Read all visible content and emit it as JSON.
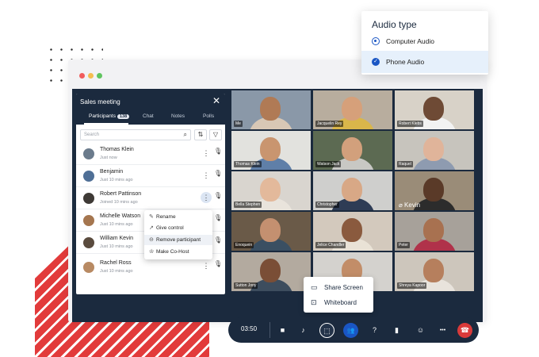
{
  "panel": {
    "title": "Sales meeting",
    "close": "✕",
    "tabs": [
      {
        "label": "Participants",
        "count": "138"
      },
      {
        "label": "Chat"
      },
      {
        "label": "Notes"
      },
      {
        "label": "Polls"
      }
    ],
    "search_placeholder": "Search",
    "participants": [
      {
        "name": "Thomas Klein",
        "status": "Just now",
        "avatar": "#6b7b8c"
      },
      {
        "name": "Benjamin",
        "status": "Just 10 mins ago",
        "avatar": "#4f6f96"
      },
      {
        "name": "Robert Pattinson",
        "status": "Joined 10 mins ago",
        "avatar": "#3e3a36"
      },
      {
        "name": "Michelle Watson",
        "status": "Just 10 mins ago",
        "avatar": "#a5764f"
      },
      {
        "name": "William Kevin",
        "status": "Just 10 mins ago",
        "avatar": "#5a4b3e"
      },
      {
        "name": "Rachel Ross",
        "status": "Just 10 mins ago",
        "avatar": "#b88a63"
      }
    ]
  },
  "context_menu": {
    "items": [
      {
        "label": "Rename",
        "icon": "pencil-icon",
        "glyph": "✎"
      },
      {
        "label": "Give control",
        "icon": "pointer-icon",
        "glyph": "↗"
      },
      {
        "label": "Remove participant",
        "icon": "remove-icon",
        "glyph": "⊖"
      },
      {
        "label": "Make Co-Host",
        "icon": "crown-icon",
        "glyph": "♔"
      }
    ]
  },
  "video_tiles": [
    {
      "name": "Me",
      "bg": "#8a98a8",
      "skin": "#b07a55",
      "shirt": "#d8c7b5"
    },
    {
      "name": "Jacquelin Rey",
      "bg": "#b8ad9e",
      "skin": "#d6a07a",
      "shirt": "#d9b64a"
    },
    {
      "name": "Robert Klebs",
      "bg": "#d8d2c8",
      "skin": "#6e4a35",
      "shirt": "#f2f2f2"
    },
    {
      "name": "Thomas Klein",
      "bg": "#e2e2de",
      "skin": "#c9956f",
      "shirt": "#5f7fa8"
    },
    {
      "name": "Watson Jack",
      "bg": "#5c6a52",
      "skin": "#d2a07c",
      "shirt": "#c8c8c4"
    },
    {
      "name": "Raquel",
      "bg": "#c7c4bd",
      "skin": "#e0b49a",
      "shirt": "#8e9bb0"
    },
    {
      "name": "Bella Stephen",
      "bg": "#d9d5cf",
      "skin": "#e3b99b",
      "shirt": "#e9e4dc"
    },
    {
      "name": "Christopher",
      "bg": "#cfcfcd",
      "skin": "#d8a886",
      "shirt": "#2e3c55"
    },
    {
      "name": "Kevin",
      "bg": "#9a8c78",
      "skin": "#5a3a28",
      "shirt": "#2c2c2c"
    },
    {
      "name": "Enoquein",
      "bg": "#6a5a48",
      "skin": "#c49070",
      "shirt": "#3a4f62"
    },
    {
      "name": "Jelice Chandler",
      "bg": "#d3c9bd",
      "skin": "#8a5a3e",
      "shirt": "#e9e2d6"
    },
    {
      "name": "Peter",
      "bg": "#a7a19a",
      "skin": "#a87150",
      "shirt": "#b0324a"
    },
    {
      "name": "Sutton Jony",
      "bg": "#b3aa9f",
      "skin": "#7a4e36",
      "shirt": "#3d4d5e"
    },
    {
      "name": "",
      "bg": "#d4d2ce",
      "skin": "#c28d68",
      "shirt": "#3a4660"
    },
    {
      "name": "Shreya Kapoor",
      "bg": "#cdc6bc",
      "skin": "#b67f5d",
      "shirt": "#e8e3dc"
    }
  ],
  "audio_popup": {
    "title": "Audio type",
    "options": [
      {
        "label": "Computer Audio"
      },
      {
        "label": "Phone Audio",
        "check": "✓"
      }
    ]
  },
  "share_menu": {
    "items": [
      {
        "label": "Share Screen",
        "glyph": "▭"
      },
      {
        "label": "Whiteboard",
        "glyph": "⊡"
      }
    ]
  },
  "toolbar": {
    "timer": "03:50",
    "buttons": [
      {
        "name": "camera-icon",
        "glyph": "■"
      },
      {
        "name": "microphone-icon",
        "glyph": "♪"
      },
      {
        "name": "share-screen-icon",
        "glyph": "⬚"
      },
      {
        "name": "participants-icon",
        "glyph": "👥"
      },
      {
        "name": "question-icon",
        "glyph": "?"
      },
      {
        "name": "stats-icon",
        "glyph": "▮"
      },
      {
        "name": "reactions-icon",
        "glyph": "☺"
      },
      {
        "name": "more-icon",
        "glyph": "•••"
      },
      {
        "name": "end-call-icon",
        "glyph": "☎"
      }
    ]
  },
  "colors": {
    "accent": "#1a56c4",
    "navy": "#1b2a3e",
    "end_call": "#d93a3a"
  }
}
